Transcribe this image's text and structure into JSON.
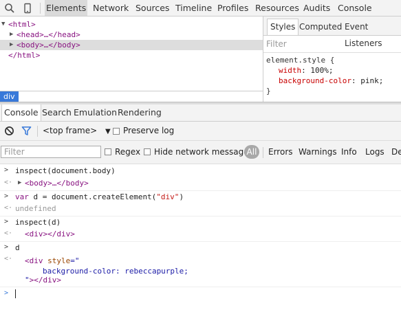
{
  "toolbar": {
    "tabs": [
      "Elements",
      "Network",
      "Sources",
      "Timeline",
      "Profiles",
      "Resources",
      "Audits",
      "Console"
    ],
    "active_tab": "Elements"
  },
  "elements": {
    "lines": {
      "html_open": "<html>",
      "head": "<head>…</head>",
      "body": "<body>…</body>",
      "html_close": "</html>"
    },
    "breadcrumb": "div"
  },
  "styles": {
    "tabs": [
      "Styles",
      "Computed",
      "Event Listeners"
    ],
    "filter_placeholder": "Filter",
    "selector": "element.style {",
    "props": [
      {
        "name": "width",
        "value": "100%;"
      },
      {
        "name": "background-color",
        "value": "pink;"
      }
    ],
    "close": "}"
  },
  "drawer": {
    "tabs": [
      "Console",
      "Search",
      "Emulation",
      "Rendering"
    ]
  },
  "console_toolbar": {
    "context": "<top frame>",
    "preserve_log": "Preserve log"
  },
  "filterbar": {
    "placeholder": "Filter",
    "regex": "Regex",
    "hide_network": "Hide network messages",
    "levels": [
      "All",
      "Errors",
      "Warnings",
      "Info",
      "Logs",
      "De"
    ]
  },
  "console": {
    "l1": "inspect(document.body)",
    "l2": "<body>…</body>",
    "l3_kw": "var",
    "l3_a": " d = document.createElement(",
    "l3_str": "\"div\"",
    "l3_b": ")",
    "l4": "undefined",
    "l5": "inspect(d)",
    "l6": "<div></div>",
    "l7": "d",
    "l8_tag": "<div",
    "l8_attr": " style",
    "l8_eq": "=\"",
    "l9": "background-color: rebeccapurple;",
    "l10_q": "\"",
    "l10_tag": "></div>"
  },
  "colors": {
    "selected_tab": "#dadada",
    "accent": "#3879d9",
    "filter_active": "#3879d9"
  }
}
